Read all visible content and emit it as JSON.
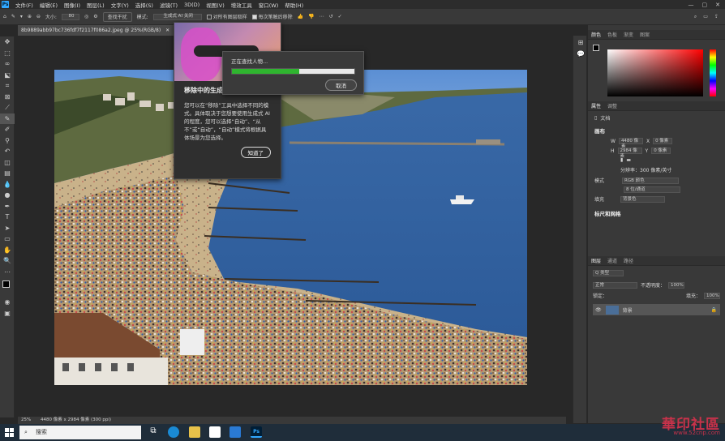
{
  "menu": {
    "items": [
      "文件(F)",
      "编辑(E)",
      "图像(I)",
      "图层(L)",
      "文字(Y)",
      "选择(S)",
      "滤镜(T)",
      "3D(D)",
      "视图(V)",
      "增效工具",
      "窗口(W)",
      "帮助(H)"
    ]
  },
  "options": {
    "size_label": "大小:",
    "size_value": "80",
    "find_button": "查找干扰",
    "mode_label": "模式:",
    "mode_value": "生成式 AI 关闭",
    "sample_all": "对所有图层取样",
    "stroke_each": "每次笔触后移除"
  },
  "document": {
    "tab_title": "8b9889abb97bc736fdf7f2117f086a2.jpeg @ 25%(RGB/8)",
    "zoom": "25%",
    "status": "4480 像素 x 2984 像素 (300 ppi)"
  },
  "tip": {
    "title": "移除中的生成式 AI",
    "body": "您可以在“移除”工具中选择不同的模式。具体取决于您想要使用生成式 AI 的程度，您可以选择“自动”、“从不”或“自动”，“自动”模式将根据具体场景为您选择。",
    "button": "知道了"
  },
  "progress": {
    "label": "正在查找人物...",
    "percent": 55,
    "cancel": "取消"
  },
  "right": {
    "color_tabs": [
      "颜色",
      "色板",
      "渐变",
      "图案"
    ],
    "prop_tabs": [
      "属性",
      "调整"
    ],
    "doc_label": "文档",
    "canvas_title": "画布",
    "w_label": "W",
    "w_value": "4480 像素",
    "x_label": "X",
    "x_value": "0 像素",
    "h_label": "H",
    "h_value": "2984 像素",
    "y_label": "Y",
    "y_value": "0 像素",
    "resolution": "分辨率：300 像素/英寸",
    "mode_label": "模式",
    "mode_value": "RGB 颜色",
    "bits_value": "8 位/通道",
    "bg_label": "填充",
    "bg_value": "背景色",
    "rulers_title": "标尺和网格",
    "layer_tabs": [
      "图层",
      "通道",
      "路径"
    ],
    "kind_label": "Q 类型",
    "blend": "正常",
    "opacity_label": "不透明度：",
    "opacity_value": "100%",
    "lock_label": "锁定：",
    "fill_label": "填充：",
    "fill_value": "100%",
    "layer_name": "背景"
  },
  "taskbar": {
    "search": "搜索"
  },
  "watermark": {
    "text": "華印社區",
    "url": "www.52cnp.com"
  },
  "colors": {
    "accent": "#31a8ff",
    "progress": "#2fb52f",
    "ui_bg": "#393939"
  }
}
